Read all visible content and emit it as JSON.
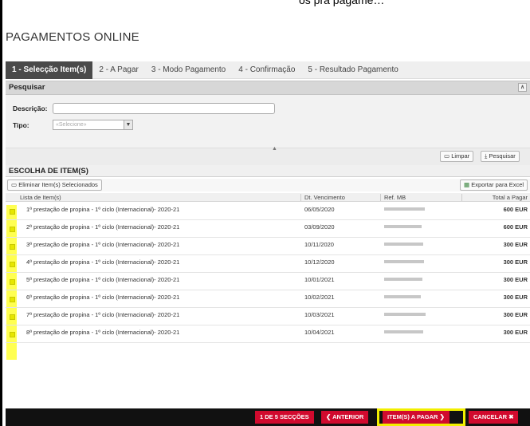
{
  "header_snippet": "os pra pagame…",
  "page_title": "PAGAMENTOS ONLINE",
  "tabs": [
    {
      "label": "1 - Selecção Item(s)",
      "active": true
    },
    {
      "label": "2 - A Pagar",
      "active": false
    },
    {
      "label": "3 - Modo Pagamento",
      "active": false
    },
    {
      "label": "4 - Confirmação",
      "active": false
    },
    {
      "label": "5 - Resultado Pagamento",
      "active": false
    }
  ],
  "search": {
    "title": "Pesquisar",
    "descricao_label": "Descrição:",
    "descricao_value": "",
    "tipo_label": "Tipo:",
    "tipo_placeholder": "«Selecione»",
    "clear_label": "Limpar",
    "search_label": "Pesquisar"
  },
  "selection": {
    "title": "ESCOLHA DE ITEM(S)",
    "remove_label": "Eliminar Item(s) Selecionados",
    "export_label": "Exportar para Excel",
    "columns": [
      "Lista de Item(s)",
      "Dt. Vencimento",
      "Ref. MB",
      "Total a Pagar"
    ],
    "rows": [
      {
        "item": "1ª prestação de propina - 1º ciclo (Internacional)- 2020-21",
        "due": "06/05/2020",
        "amount": "600 EUR"
      },
      {
        "item": "2ª prestação de propina - 1º ciclo (Internacional)- 2020-21",
        "due": "03/09/2020",
        "amount": "600 EUR"
      },
      {
        "item": "3ª prestação de propina - 1º ciclo (Internacional)- 2020-21",
        "due": "10/11/2020",
        "amount": "300 EUR"
      },
      {
        "item": "4ª prestação de propina - 1º ciclo (Internacional)- 2020-21",
        "due": "10/12/2020",
        "amount": "300 EUR"
      },
      {
        "item": "5ª prestação de propina - 1º ciclo (Internacional)- 2020-21",
        "due": "10/01/2021",
        "amount": "300 EUR"
      },
      {
        "item": "6ª prestação de propina - 1º ciclo (Internacional)- 2020-21",
        "due": "10/02/2021",
        "amount": "300 EUR"
      },
      {
        "item": "7ª prestação de propina - 1º ciclo (Internacional)- 2020-21",
        "due": "10/03/2021",
        "amount": "300 EUR"
      },
      {
        "item": "8ª prestação de propina - 1º ciclo (Internacional)- 2020-21",
        "due": "10/04/2021",
        "amount": "300 EUR"
      }
    ]
  },
  "footer": {
    "sections": "1 DE 5 SECÇÕES",
    "previous": "ANTERIOR",
    "next": "ITEM(S) A PAGAR",
    "cancel": "CANCELAR"
  },
  "colors": {
    "accent": "#d10a2e",
    "highlight": "#ffff33",
    "active_tab": "#4a4a4a"
  }
}
